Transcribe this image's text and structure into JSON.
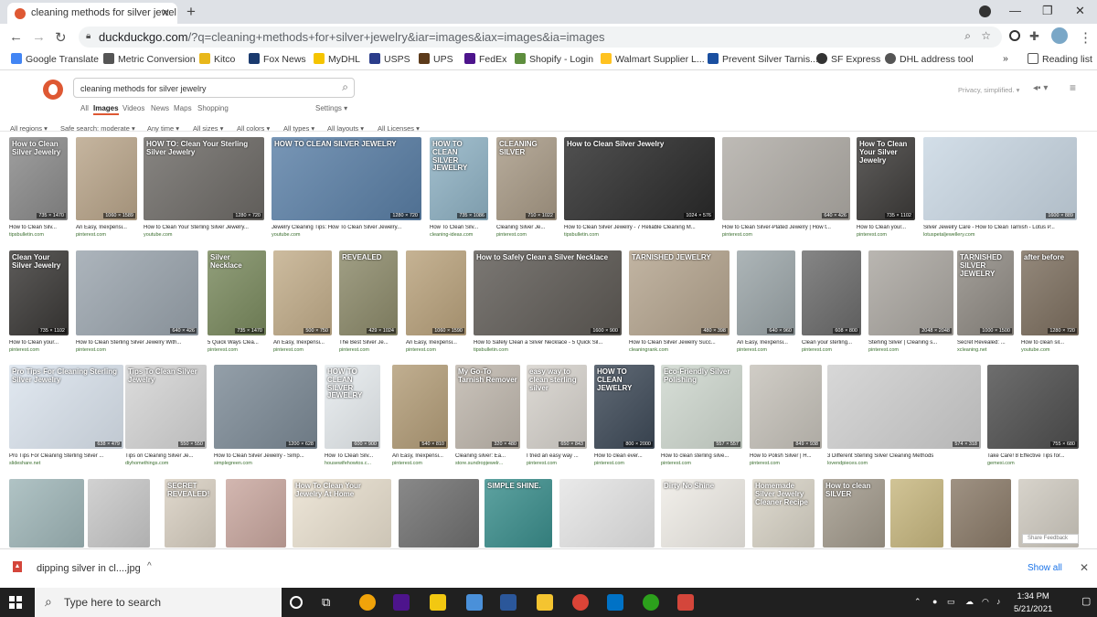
{
  "browser": {
    "tab_title": "cleaning methods for silver jewel",
    "tab_close": "✕",
    "new_tab": "+",
    "url_host": "duckduckgo.com",
    "url_path": "/?q=cleaning+methods+for+silver+jewelry&iar=images&iax=images&ia=images",
    "win_min": "—",
    "win_max": "❐",
    "win_close": "✕"
  },
  "bookmarks": [
    {
      "label": "Google Translate",
      "icon": "translate-icon",
      "color": "#4285f4"
    },
    {
      "label": "Metric Conversion",
      "icon": "metric-icon",
      "color": "#555555"
    },
    {
      "label": "Kitco",
      "icon": "kitco-icon",
      "color": "#e8b71a"
    },
    {
      "label": "Fox News",
      "icon": "fox-icon",
      "color": "#1a3a6e"
    },
    {
      "label": "MyDHL",
      "icon": "dhl-icon",
      "color": "#f5c400"
    },
    {
      "label": "USPS",
      "icon": "usps-icon",
      "color": "#2b3d8b"
    },
    {
      "label": "UPS",
      "icon": "ups-icon",
      "color": "#5c3a1a"
    },
    {
      "label": "FedEx",
      "icon": "fedex-icon",
      "color": "#4d148c"
    },
    {
      "label": "Shopify - Login",
      "icon": "shopify-icon",
      "color": "#5e8e3e"
    },
    {
      "label": "Walmart Supplier L...",
      "icon": "walmart-icon",
      "color": "#ffc220"
    },
    {
      "label": "Prevent Silver Tarnis...",
      "icon": "page-icon",
      "color": "#1a4fa0"
    },
    {
      "label": "SF Express",
      "icon": "sf-icon",
      "color": "#333333"
    },
    {
      "label": "DHL address tool",
      "icon": "globe-icon",
      "color": "#555555"
    }
  ],
  "reading_list": "Reading list",
  "bookmarks_more": "»",
  "ddg": {
    "query": "cleaning methods for silver jewelry",
    "tabs": [
      "All",
      "Images",
      "Videos",
      "News",
      "Maps",
      "Shopping"
    ],
    "settings": "Settings ▾",
    "privacy": "Privacy, simplified. ▾",
    "filters": [
      "All regions ▾",
      "Safe search: moderate ▾",
      "Any time ▾",
      "All sizes ▾",
      "All colors ▾",
      "All types ▾",
      "All layouts ▾",
      "All Licenses ▾"
    ]
  },
  "results": [
    {
      "caption": "How to Clean Silv...",
      "source": "tipsbulletin.com",
      "dim": "735 × 1470",
      "overlay": "How to Clean Silver Jewelry",
      "bg": "#8a8a8a"
    },
    {
      "caption": "An Easy, Inexpensi...",
      "source": "pinterest.com",
      "dim": "1060 × 1589",
      "overlay": "",
      "bg": "#b9a58a"
    },
    {
      "caption": "How to Clean Your Sterling Silver Jewelry...",
      "source": "youtube.com",
      "dim": "1280 × 720",
      "overlay": "HOW TO: Clean Your Sterling Silver Jewelry",
      "bg": "#6d6a66"
    },
    {
      "caption": "Jewelry Cleaning Tips: How To Clean Silver Jewelry...",
      "source": "youtube.com",
      "dim": "1280 × 720",
      "overlay": "HOW TO CLEAN SILVER JEWELRY",
      "bg": "#5a7fa6"
    },
    {
      "caption": "How To Clean Silv...",
      "source": "cleaning-ideas.com",
      "dim": "735 × 1086",
      "overlay": "HOW TO CLEAN SILVER JEWELRY",
      "bg": "#8fb2c4"
    },
    {
      "caption": "Cleaning Silver Je...",
      "source": "pinterest.com",
      "dim": "710 × 1022",
      "overlay": "CLEANING SILVER",
      "bg": "#a89a86"
    },
    {
      "caption": "How to Clean Silver Jewelry - 7 Reliable Cleaning M...",
      "source": "tipsbulletin.com",
      "dim": "1024 × 576",
      "overlay": "How to Clean Silver Jewelry",
      "bg": "#2a2a2a"
    },
    {
      "caption": "How to Clean Silver-Plated Jewelry | How t...",
      "source": "pinterest.com",
      "dim": "640 × 426",
      "overlay": "",
      "bg": "#b0aca6"
    },
    {
      "caption": "How to Clean your...",
      "source": "pinterest.com",
      "dim": "735 × 1102",
      "overlay": "How To Clean Your Silver Jewelry",
      "bg": "#3d3b39"
    },
    {
      "caption": "Silver Jewelry Care - How to Clean Tarnish - Lotus P...",
      "source": "lotuspetaljewellery.com",
      "dim": "1600 × 889",
      "overlay": "",
      "bg": "#c9d7e3"
    },
    {
      "caption": "How to Clean your...",
      "source": "pinterest.com",
      "dim": "735 × 1102",
      "overlay": "Clean Your Silver Jewelry",
      "bg": "#3a3836"
    },
    {
      "caption": "How to Clean Sterling Silver Jewelry With...",
      "source": "pinterest.com",
      "dim": "640 × 426",
      "overlay": "",
      "bg": "#9aa4ad"
    },
    {
      "caption": "5 Quick Ways Clea...",
      "source": "pinterest.com",
      "dim": "735 × 1470",
      "overlay": "Silver Necklace",
      "bg": "#7a8a5e"
    },
    {
      "caption": "An Easy, Inexpensi...",
      "source": "pinterest.com",
      "dim": "500 × 750",
      "overlay": "",
      "bg": "#c2ad8a"
    },
    {
      "caption": "The Best Silver Je...",
      "source": "pinterest.com",
      "dim": "429 × 1024",
      "overlay": "REVEALED",
      "bg": "#8c8a6a"
    },
    {
      "caption": "An Easy, Inexpensi...",
      "source": "pinterest.com",
      "dim": "1060 × 1590",
      "overlay": "",
      "bg": "#b9a27c"
    },
    {
      "caption": "How to Safely Clean a Silver Necklace - 5 Quick Sil...",
      "source": "tipsbulletin.com",
      "dim": "1600 × 900",
      "overlay": "How to Safely Clean a Silver Necklace",
      "bg": "#5e5a55"
    },
    {
      "caption": "How to Clean Silver Jewelry Succ...",
      "source": "cleaningrank.com",
      "dim": "480 × 398",
      "overlay": "TARNISHED JEWELRY",
      "bg": "#b4a48e"
    },
    {
      "caption": "An Easy, Inexpensi...",
      "source": "pinterest.com",
      "dim": "640 × 960",
      "overlay": "",
      "bg": "#9ba5a8"
    },
    {
      "caption": "Clean your sterling...",
      "source": "pinterest.com",
      "dim": "608 × 800",
      "overlay": "",
      "bg": "#6b6b6b"
    },
    {
      "caption": "Sterling Silver | Cleaning s...",
      "source": "pinterest.com",
      "dim": "2048 × 2048",
      "overlay": "",
      "bg": "#aaa6a0"
    },
    {
      "caption": "Secret Revealed: ...",
      "source": "xcleaning.net",
      "dim": "1000 × 1500",
      "overlay": "TARNISHED SILVER JEWELRY",
      "bg": "#8f8a83"
    },
    {
      "caption": "How to clean sil...",
      "source": "youtube.com",
      "dim": "1280 × 720",
      "overlay": "after before",
      "bg": "#7d6f5f"
    },
    {
      "caption": "Pro Tips For Cleaning Sterling Silver ...",
      "source": "slideshare.net",
      "dim": "638 × 479",
      "overlay": "Pro Tips For Cleaning Sterling Silver Jewelry",
      "bg": "#dbe4ee"
    },
    {
      "caption": "Tips on Cleaning Silver Je...",
      "source": "diyhomethings.com",
      "dim": "550 × 550",
      "overlay": "Tips To Clean Silver Jewelry",
      "bg": "#d5d5d5"
    },
    {
      "caption": "How to Clean Silver Jewelry - Simp...",
      "source": "simplegreen.com",
      "dim": "1200 × 628",
      "overlay": "",
      "bg": "#7c8a96"
    },
    {
      "caption": "How To Clean Silv...",
      "source": "housewifehowtos.c...",
      "dim": "600 × 900",
      "overlay": "HOW TO CLEAN SILVER JEWELRY",
      "bg": "#e7ecef"
    },
    {
      "caption": "An Easy, Inexpensi...",
      "source": "pinterest.com",
      "dim": "540 × 810",
      "overlay": "",
      "bg": "#b39d78"
    },
    {
      "caption": "Cleaning silver: Ea...",
      "source": "store.sundropjewelr...",
      "dim": "320 × 480",
      "overlay": "My Go-To Tarnish Remover",
      "bg": "#bfb7ad"
    },
    {
      "caption": "I tried an easy way ...",
      "source": "pinterest.com",
      "dim": "650 × 843",
      "overlay": "easy way to clean sterling silver",
      "bg": "#d6d2cc"
    },
    {
      "caption": "How to clean ever...",
      "source": "pinterest.com",
      "dim": "800 × 2000",
      "overlay": "HOW TO CLEAN JEWELRY",
      "bg": "#3e4a58"
    },
    {
      "caption": "How to clean sterling silve...",
      "source": "pinterest.com",
      "dim": "557 × 557",
      "overlay": "Eco-Friendly Silver Polishing",
      "bg": "#cfd8cf"
    },
    {
      "caption": "How to Polish Silver | H...",
      "source": "pinterest.com",
      "dim": "849 × 938",
      "overlay": "",
      "bg": "#c6c2ba"
    },
    {
      "caption": "3 Different Sterling Silver Cleaning Methods",
      "source": "lovendpieces.com",
      "dim": "574 × 318",
      "overlay": "",
      "bg": "#cfcfcf"
    },
    {
      "caption": "Take Care! 8 Effective Tips for...",
      "source": "gemexi.com",
      "dim": "755 × 680",
      "overlay": "",
      "bg": "#4e4e4e"
    },
    {
      "caption": "",
      "source": "",
      "dim": "",
      "overlay": "",
      "bg": "#9fb6b8"
    },
    {
      "caption": "",
      "source": "",
      "dim": "",
      "overlay": "",
      "bg": "#c8c8c8"
    },
    {
      "caption": "",
      "source": "",
      "dim": "",
      "overlay": "SECRET REVEALED!",
      "bg": "#d9d0c2"
    },
    {
      "caption": "",
      "source": "",
      "dim": "",
      "overlay": "",
      "bg": "#c9a79f"
    },
    {
      "caption": "",
      "source": "",
      "dim": "",
      "overlay": "How To Clean Your Jewelry At Home",
      "bg": "#e9e0cf"
    },
    {
      "caption": "",
      "source": "",
      "dim": "",
      "overlay": "",
      "bg": "#6f6f6f"
    },
    {
      "caption": "",
      "source": "",
      "dim": "",
      "overlay": "SIMPLE SHINE.",
      "bg": "#3a8e8c"
    },
    {
      "caption": "",
      "source": "",
      "dim": "",
      "overlay": "",
      "bg": "#e5e5e5"
    },
    {
      "caption": "",
      "source": "",
      "dim": "",
      "overlay": "Dirty No Shine",
      "bg": "#efece6"
    },
    {
      "caption": "",
      "source": "",
      "dim": "",
      "overlay": "Homemade Silver Jewelry Cleaner Recipe",
      "bg": "#d8d3c6"
    },
    {
      "caption": "",
      "source": "",
      "dim": "",
      "overlay": "How to clean SILVER",
      "bg": "#a29a8c"
    },
    {
      "caption": "",
      "source": "",
      "dim": "",
      "overlay": "",
      "bg": "#c7b77f"
    },
    {
      "caption": "",
      "source": "",
      "dim": "",
      "overlay": "",
      "bg": "#8a7a68"
    },
    {
      "caption": "",
      "source": "",
      "dim": "",
      "overlay": "",
      "bg": "#cfcac0"
    }
  ],
  "share_feedback": "Share Feedback",
  "download": {
    "filename": "dipping silver in cl....jpg",
    "show_all": "Show all",
    "chevron": "^",
    "close": "✕"
  },
  "taskbar": {
    "search_placeholder": "Type here to search",
    "time": "1:34 PM",
    "date": "5/21/2021"
  }
}
